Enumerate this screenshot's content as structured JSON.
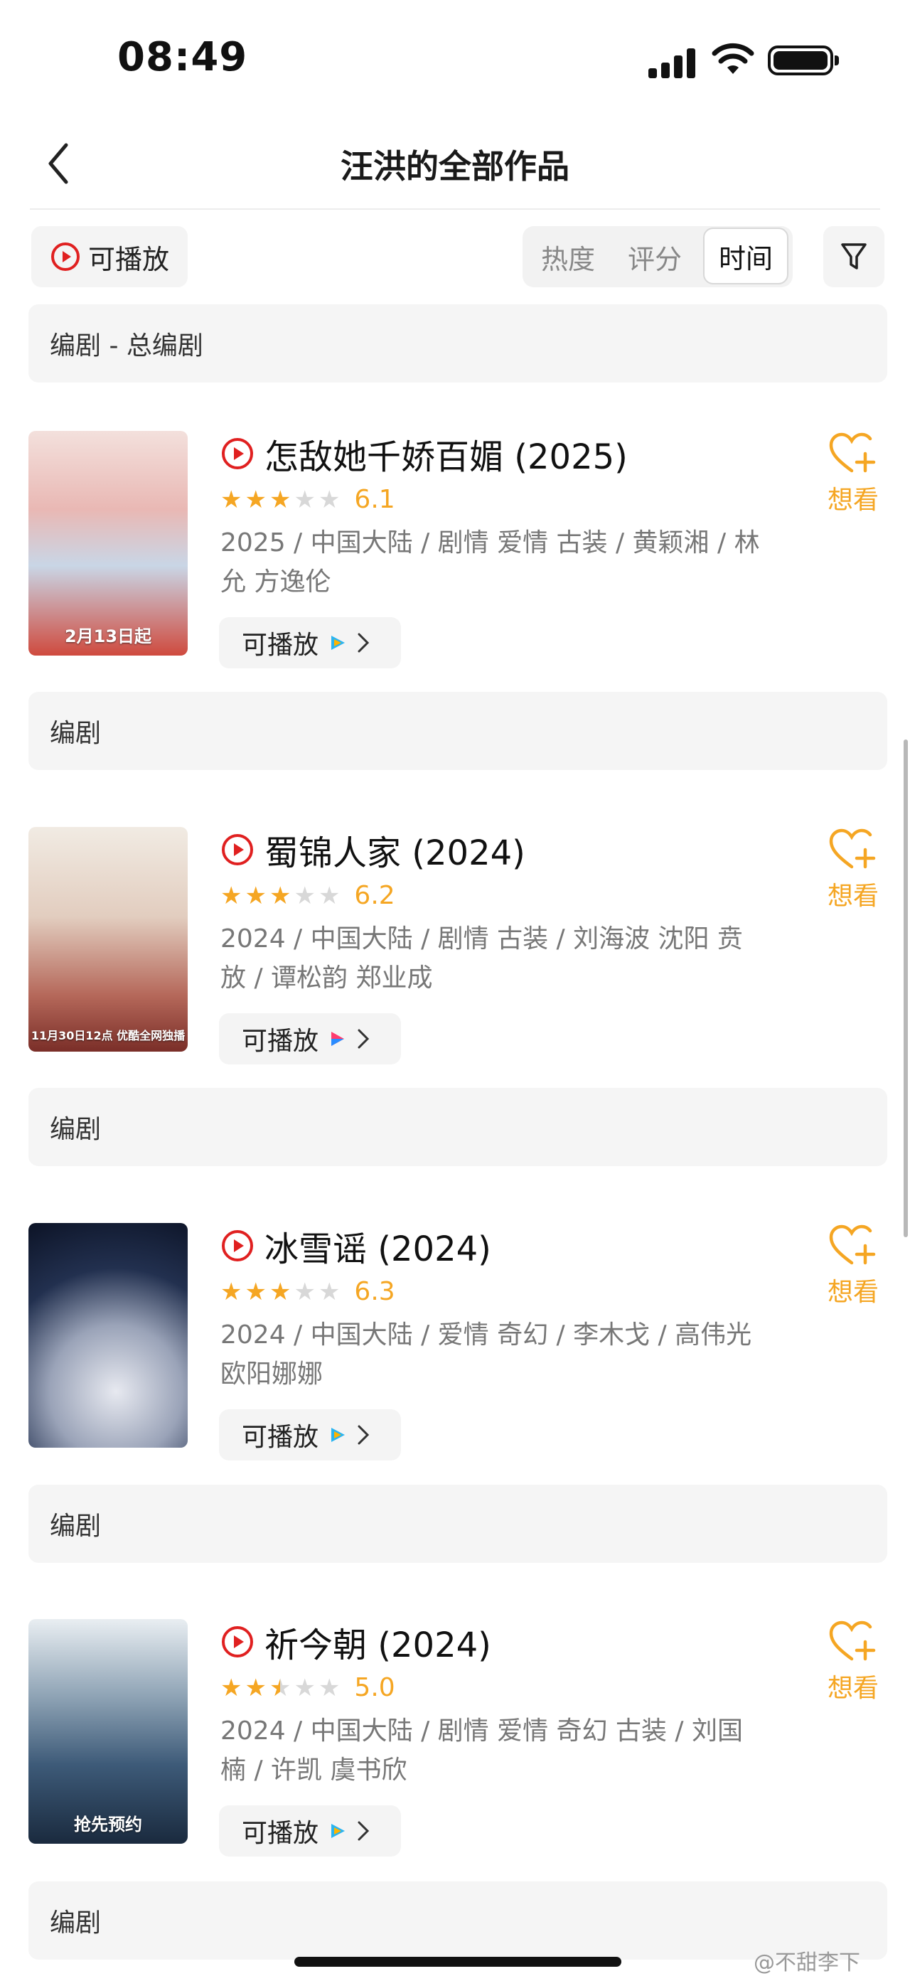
{
  "status_bar": {
    "time": "08:49"
  },
  "nav": {
    "title": "汪洪的全部作品"
  },
  "filters": {
    "playable_label": "可播放",
    "sort_options": [
      "热度",
      "评分",
      "时间"
    ],
    "active_sort": "时间"
  },
  "section_first": "编剧 - 总编剧",
  "section_label": "编剧",
  "works": [
    {
      "title": "怎敌她千娇百媚 (2025)",
      "rating": 6.1,
      "stars": 3,
      "score": "6.1",
      "meta": "2025 / 中国大陆 / 剧情 爱情 古装 / 黄颖湘 / 林允 方逸伦",
      "poster_caption": "2月13日起",
      "playable_label": "可播放",
      "want_label": "想看"
    },
    {
      "title": "蜀锦人家 (2024)",
      "rating": 6.2,
      "stars": 3,
      "score": "6.2",
      "meta": "2024 / 中国大陆 / 剧情 古装 / 刘海波 沈阳 贲放 / 谭松韵 郑业成",
      "poster_caption": "11月30日12点 优酷全网独播",
      "playable_label": "可播放",
      "want_label": "想看"
    },
    {
      "title": "冰雪谣 (2024)",
      "rating": 6.3,
      "stars": 3,
      "score": "6.3",
      "meta": "2024 / 中国大陆 / 爱情 奇幻 / 李木戈 / 高伟光 欧阳娜娜",
      "poster_caption": "",
      "playable_label": "可播放",
      "want_label": "想看"
    },
    {
      "title": "祈今朝 (2024)",
      "rating": 5.0,
      "stars": 2.5,
      "score": "5.0",
      "meta": "2024 / 中国大陆 / 剧情 爱情 奇幻 古装 / 刘国楠 / 许凯 虞书欣",
      "poster_caption": "抢先预约",
      "playable_label": "可播放",
      "want_label": "想看"
    }
  ],
  "watermark": "@不甜李下",
  "colors": {
    "accent": "#f5a623",
    "play_red": "#e02020"
  }
}
